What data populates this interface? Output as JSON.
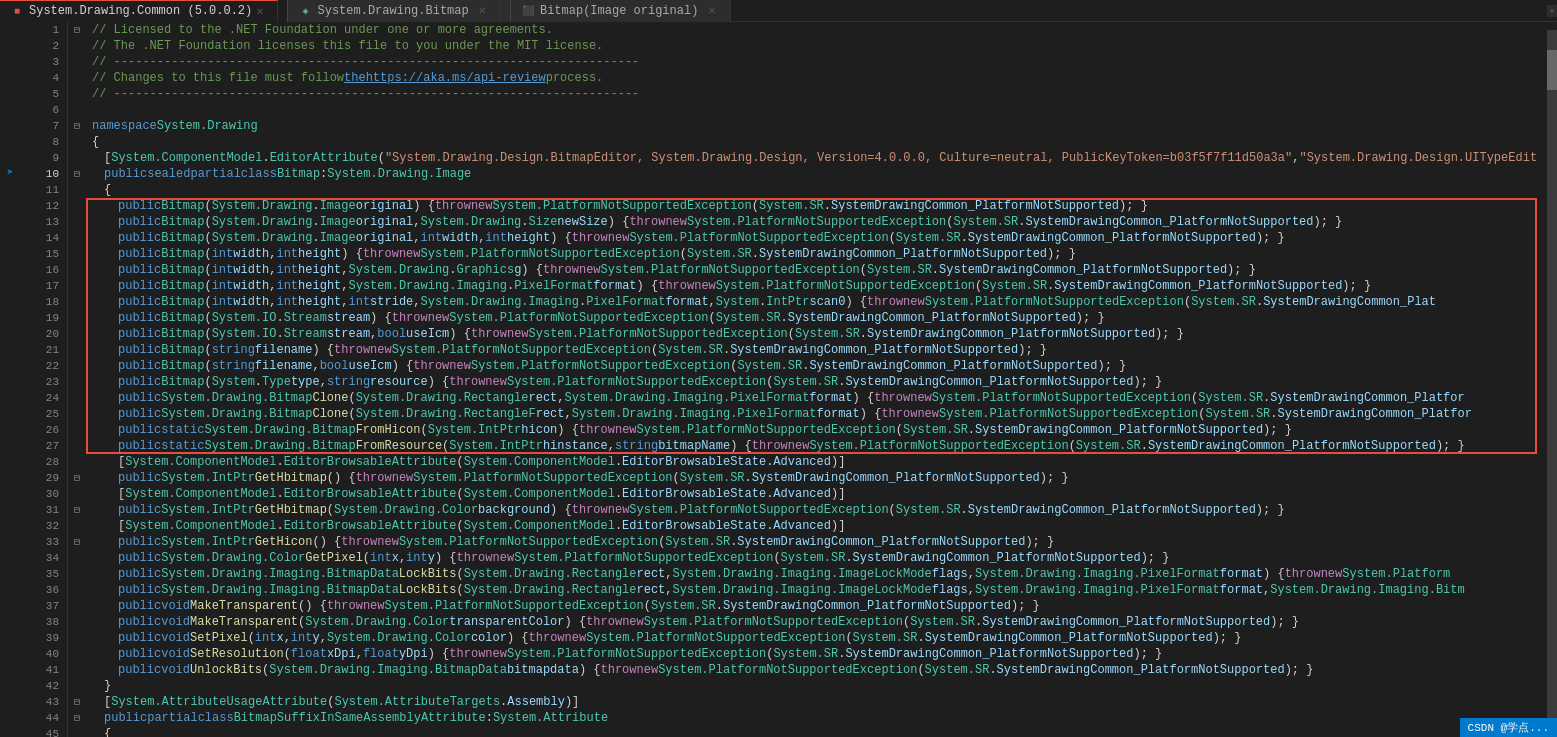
{
  "titleBar": {
    "tabs": [
      {
        "id": "tab1",
        "icon": "file-icon",
        "label": "System.Drawing.Common (5.0.0.2)",
        "active": true,
        "hasClose": false
      },
      {
        "id": "tab2",
        "icon": "file-icon",
        "label": "System.Drawing.Bitmap",
        "active": false,
        "hasClose": false
      },
      {
        "id": "tab3",
        "icon": "bitmap-icon",
        "label": "Bitmap(Image original)",
        "active": false,
        "hasClose": false
      }
    ]
  },
  "statusBar": {
    "text": "CSDN @学点..."
  },
  "lines": [
    {
      "num": 1,
      "indent": 0,
      "collapse": true,
      "content": "// Licensed to the .NET Foundation under one or more agreements.",
      "type": "comment"
    },
    {
      "num": 2,
      "indent": 0,
      "collapse": false,
      "content": "// The .NET Foundation licenses this file to you under the MIT license.",
      "type": "comment"
    },
    {
      "num": 3,
      "indent": 0,
      "collapse": false,
      "content": "// -------------------------------------------------------------------",
      "type": "comment"
    },
    {
      "num": 4,
      "indent": 0,
      "collapse": false,
      "content": "// Changes to this file must follow the https://aka.ms/api-review process.",
      "type": "comment_link"
    },
    {
      "num": 5,
      "indent": 0,
      "collapse": false,
      "content": "// -------------------------------------------------------------------",
      "type": "comment"
    },
    {
      "num": 6,
      "indent": 0,
      "collapse": false,
      "content": "",
      "type": "empty"
    },
    {
      "num": 7,
      "indent": 0,
      "collapse": true,
      "content": "namespace System.Drawing",
      "type": "namespace"
    },
    {
      "num": 8,
      "indent": 0,
      "collapse": false,
      "content": "{",
      "type": "punc"
    },
    {
      "num": 9,
      "indent": 1,
      "collapse": false,
      "content": "[System.ComponentModel.EditorAttribute(\"System.Drawing.Design.BitmapEditor, System.Drawing.Design, Version=4.0.0.0, Culture=neutral, PublicKeyToken=b03f5f7f11d50a3a\", \"System.Drawing.Design.UITypeEdit",
      "type": "attr"
    },
    {
      "num": 10,
      "indent": 1,
      "collapse": true,
      "content": "public sealed partial class Bitmap : System.Drawing.Image",
      "type": "class"
    },
    {
      "num": 11,
      "indent": 1,
      "collapse": false,
      "content": "{",
      "type": "punc"
    },
    {
      "num": 12,
      "indent": 2,
      "collapse": false,
      "content": "public Bitmap(System.Drawing.Image original) { throw new System.PlatformNotSupportedException(System.SR.SystemDrawingCommon_PlatformNotSupported); }",
      "type": "code_highlight"
    },
    {
      "num": 13,
      "indent": 2,
      "collapse": false,
      "content": "public Bitmap(System.Drawing.Image original, System.Drawing.Size newSize) { throw new System.PlatformNotSupportedException(System.SR.SystemDrawingCommon_PlatformNotSupported); }",
      "type": "code_highlight"
    },
    {
      "num": 14,
      "indent": 2,
      "collapse": false,
      "content": "public Bitmap(System.Drawing.Image original, int width, int height) { throw new System.PlatformNotSupportedException(System.SR.SystemDrawingCommon_PlatformNotSupported); }",
      "type": "code_highlight"
    },
    {
      "num": 15,
      "indent": 2,
      "collapse": false,
      "content": "public Bitmap(int width, int height) { throw new System.PlatformNotSupportedException(System.SR.SystemDrawingCommon_PlatformNotSupported); }",
      "type": "code_highlight"
    },
    {
      "num": 16,
      "indent": 2,
      "collapse": false,
      "content": "public Bitmap(int width, int height, System.Drawing.Graphics g) { throw new System.PlatformNotSupportedException(System.SR.SystemDrawingCommon_PlatformNotSupported); }",
      "type": "code_highlight"
    },
    {
      "num": 17,
      "indent": 2,
      "collapse": false,
      "content": "public Bitmap(int width, int height, System.Drawing.Imaging.PixelFormat format) { throw new System.PlatformNotSupportedException(System.SR.SystemDrawingCommon_PlatformNotSupported); }",
      "type": "code_highlight"
    },
    {
      "num": 18,
      "indent": 2,
      "collapse": false,
      "content": "public Bitmap(int width, int height, int stride, System.Drawing.Imaging.PixelFormat format, System.IntPtr scan0) { throw new System.PlatformNotSupportedException(System.SR.SystemDrawingCommon_Plat",
      "type": "code_highlight"
    },
    {
      "num": 19,
      "indent": 2,
      "collapse": false,
      "content": "public Bitmap(System.IO.Stream stream) { throw new System.PlatformNotSupportedException(System.SR.SystemDrawingCommon_PlatformNotSupported); }",
      "type": "code_highlight"
    },
    {
      "num": 20,
      "indent": 2,
      "collapse": false,
      "content": "public Bitmap(System.IO.Stream stream, bool useIcm) { throw new System.PlatformNotSupportedException(System.SR.SystemDrawingCommon_PlatformNotSupported); }",
      "type": "code_highlight"
    },
    {
      "num": 21,
      "indent": 2,
      "collapse": false,
      "content": "public Bitmap(string filename) { throw new System.PlatformNotSupportedException(System.SR.SystemDrawingCommon_PlatformNotSupported); }",
      "type": "code_highlight"
    },
    {
      "num": 22,
      "indent": 2,
      "collapse": false,
      "content": "public Bitmap(string filename, bool useIcm) { throw new System.PlatformNotSupportedException(System.SR.SystemDrawingCommon_PlatformNotSupported); }",
      "type": "code_highlight"
    },
    {
      "num": 23,
      "indent": 2,
      "collapse": false,
      "content": "public Bitmap(System.Type type, string resource) { throw new System.PlatformNotSupportedException(System.SR.SystemDrawingCommon_PlatformNotSupported); }",
      "type": "code_highlight"
    },
    {
      "num": 24,
      "indent": 2,
      "collapse": false,
      "content": "public System.Drawing.Bitmap Clone(System.Drawing.Rectangle rect, System.Drawing.Imaging.PixelFormat format) { throw new System.PlatformNotSupportedException(System.SR.SystemDrawingCommon_Platfor",
      "type": "code_highlight"
    },
    {
      "num": 25,
      "indent": 2,
      "collapse": false,
      "content": "public System.Drawing.Bitmap Clone(System.Drawing.RectangleF rect, System.Drawing.Imaging.PixelFormat format) { throw new System.PlatformNotSupportedException(System.SR.SystemDrawingCommon_Platfor",
      "type": "code_highlight"
    },
    {
      "num": 26,
      "indent": 2,
      "collapse": false,
      "content": "public static System.Drawing.Bitmap FromHicon(System.IntPtr hicon) { throw new System.PlatformNotSupportedException(System.SR.SystemDrawingCommon_PlatformNotSupported); }",
      "type": "code_highlight"
    },
    {
      "num": 27,
      "indent": 2,
      "collapse": false,
      "content": "public static System.Drawing.Bitmap FromResource(System.IntPtr hinstance, string bitmapName) { throw new System.PlatformNotSupportedException(System.SR.SystemDrawingCommon_PlatformNotSupported); }",
      "type": "code_highlight"
    },
    {
      "num": 28,
      "indent": 2,
      "collapse": false,
      "content": "[System.ComponentModel.EditorBrowsableAttribute(System.ComponentModel.EditorBrowsableState.Advanced)]",
      "type": "attr_normal"
    },
    {
      "num": 29,
      "indent": 2,
      "collapse": false,
      "content": "public System.IntPtr GetHbitmap() { throw new System.PlatformNotSupportedException(System.SR.SystemDrawingCommon_PlatformNotSupported); }",
      "type": "code_normal"
    },
    {
      "num": 30,
      "indent": 2,
      "collapse": false,
      "content": "[System.ComponentModel.EditorBrowsableAttribute(System.ComponentModel.EditorBrowsableState.Advanced)]",
      "type": "attr_normal"
    },
    {
      "num": 31,
      "indent": 2,
      "collapse": false,
      "content": "public System.IntPtr GetHbitmap(System.Drawing.Color background) { throw new System.PlatformNotSupportedException(System.SR.SystemDrawingCommon_PlatformNotSupported); }",
      "type": "code_normal"
    },
    {
      "num": 32,
      "indent": 2,
      "collapse": false,
      "content": "[System.ComponentModel.EditorBrowsableAttribute(System.ComponentModel.EditorBrowsableState.Advanced)]",
      "type": "attr_normal"
    },
    {
      "num": 33,
      "indent": 2,
      "collapse": false,
      "content": "public System.IntPtr GetHicon() { throw new System.PlatformNotSupportedException(System.SR.SystemDrawingCommon_PlatformNotSupported); }",
      "type": "code_normal"
    },
    {
      "num": 34,
      "indent": 2,
      "collapse": false,
      "content": "public System.Drawing.Color GetPixel(int x, int y) { throw new System.PlatformNotSupportedException(System.SR.SystemDrawingCommon_PlatformNotSupported); }",
      "type": "code_normal"
    },
    {
      "num": 35,
      "indent": 2,
      "collapse": false,
      "content": "public System.Drawing.Imaging.BitmapData LockBits(System.Drawing.Rectangle rect, System.Drawing.Imaging.ImageLockMode flags, System.Drawing.Imaging.PixelFormat format) { throw new System.Platform",
      "type": "code_normal"
    },
    {
      "num": 36,
      "indent": 2,
      "collapse": false,
      "content": "public System.Drawing.Imaging.BitmapData LockBits(System.Drawing.Rectangle rect, System.Drawing.Imaging.ImageLockMode flags, System.Drawing.Imaging.PixelFormat format, System.Drawing.Imaging.Bitm",
      "type": "code_normal"
    },
    {
      "num": 37,
      "indent": 2,
      "collapse": false,
      "content": "public void MakeTransparent() { throw new System.PlatformNotSupportedException(System.SR.SystemDrawingCommon_PlatformNotSupported); }",
      "type": "code_normal"
    },
    {
      "num": 38,
      "indent": 2,
      "collapse": false,
      "content": "public void MakeTransparent(System.Drawing.Color transparentColor) { throw new System.PlatformNotSupportedException(System.SR.SystemDrawingCommon_PlatformNotSupported); }",
      "type": "code_normal"
    },
    {
      "num": 39,
      "indent": 2,
      "collapse": false,
      "content": "public void SetPixel(int x, int y, System.Drawing.Color color) { throw new System.PlatformNotSupportedException(System.SR.SystemDrawingCommon_PlatformNotSupported); }",
      "type": "code_normal"
    },
    {
      "num": 40,
      "indent": 2,
      "collapse": false,
      "content": "public void SetResolution(float xDpi, float yDpi) { throw new System.PlatformNotSupportedException(System.SR.SystemDrawingCommon_PlatformNotSupported); }",
      "type": "code_normal"
    },
    {
      "num": 41,
      "indent": 2,
      "collapse": false,
      "content": "public void UnlockBits(System.Drawing.Imaging.BitmapData bitmapdata) { throw new System.PlatformNotSupportedException(System.SR.SystemDrawingCommon_PlatformNotSupported); }",
      "type": "code_normal"
    },
    {
      "num": 42,
      "indent": 1,
      "collapse": false,
      "content": "}",
      "type": "punc"
    },
    {
      "num": 43,
      "indent": 1,
      "collapse": true,
      "content": "[System.AttributeUsageAttribute(System.AttributeTargets.Assembly)]",
      "type": "attr_normal"
    },
    {
      "num": 44,
      "indent": 1,
      "collapse": true,
      "content": "public partial class BitmapSuffixInSameAssemblyAttribute : System.Attribute",
      "type": "class"
    },
    {
      "num": 45,
      "indent": 1,
      "collapse": false,
      "content": "{",
      "type": "punc"
    }
  ],
  "colors": {
    "background": "#1e1e1e",
    "lineNumColor": "#858585",
    "commentColor": "#6a9955",
    "keywordColor": "#569cd6",
    "typeColor": "#4ec9b0",
    "stringColor": "#ce9178",
    "methodColor": "#dcdcaa",
    "paramColor": "#9cdcfe",
    "redHighlight": "#e74c3c",
    "linkColor": "#569cd6",
    "accentBlue": "#007acc"
  }
}
